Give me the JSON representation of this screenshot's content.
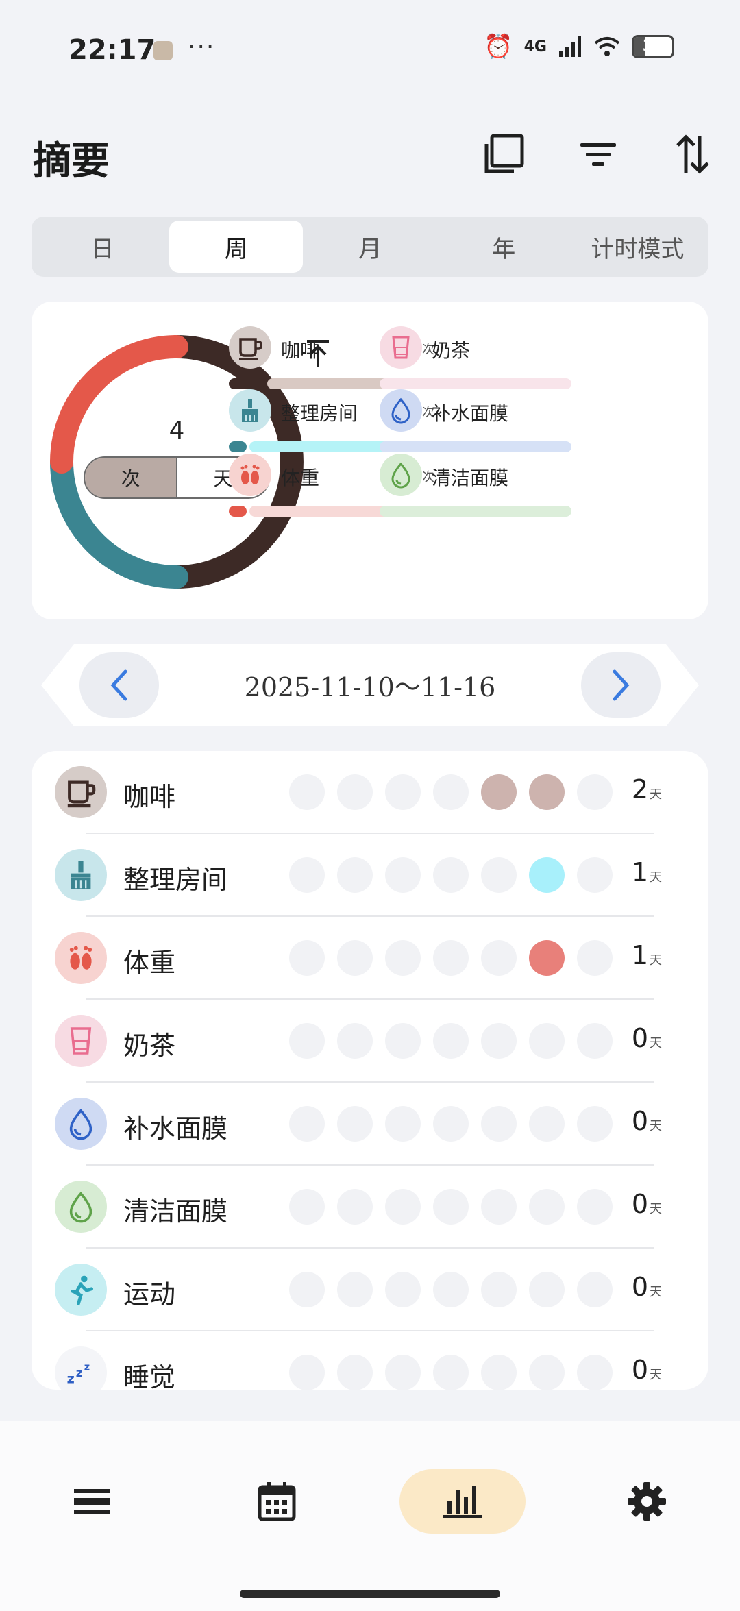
{
  "status_bar": {
    "time": "22:17",
    "dots": "···",
    "network": "4G",
    "battery": "31",
    "battery_fraction": 0.31
  },
  "header": {
    "title": "摘要"
  },
  "tabs": [
    {
      "label": "日",
      "active": false
    },
    {
      "label": "周",
      "active": true
    },
    {
      "label": "月",
      "active": false
    },
    {
      "label": "年",
      "active": false
    },
    {
      "label": "计时模式",
      "active": false
    }
  ],
  "summary": {
    "total": "4",
    "toggle": [
      {
        "label": "次",
        "active": true
      },
      {
        "label": "天",
        "active": false
      }
    ],
    "donut": [
      {
        "name": "咖啡",
        "value": 2,
        "color": "#3d2a26"
      },
      {
        "name": "整理房间",
        "value": 1,
        "color": "#3b8591"
      },
      {
        "name": "体重",
        "value": 1,
        "color": "#e4584a"
      }
    ],
    "legend": [
      {
        "name": "咖啡",
        "count": "2",
        "unit": "次",
        "icon": "coffee-cup-icon",
        "bg": "#d6ccc8",
        "color": "#3d2a26",
        "track": "#d9c9c3"
      },
      {
        "name": "奶茶",
        "count": "",
        "unit": "",
        "icon": "milk-tea-cup-icon",
        "bg": "#f7dbe3",
        "color": "#e96d8f",
        "track": "#f8e4ea"
      },
      {
        "name": "整理房间",
        "count": "1",
        "unit": "次",
        "icon": "broom-icon",
        "bg": "#c8e6eb",
        "color": "#3b8591",
        "track": "#b5f3f7"
      },
      {
        "name": "补水面膜",
        "count": "",
        "unit": "",
        "icon": "water-drop-icon",
        "bg": "#cfdaf3",
        "color": "#2f62c7",
        "track": "#d6e1f6"
      },
      {
        "name": "体重",
        "count": "1",
        "unit": "次",
        "icon": "footprints-icon",
        "bg": "#f7d3d0",
        "color": "#e4584a",
        "track": "#f7d9d7"
      },
      {
        "name": "清洁面膜",
        "count": "",
        "unit": "",
        "icon": "green-drop-icon",
        "bg": "#d7ecd3",
        "color": "#5fa34a",
        "track": "#dceeda"
      }
    ]
  },
  "date_range": {
    "label": "2025-11-10～11-16"
  },
  "list": [
    {
      "name": "咖啡",
      "value": "2",
      "unit": "天",
      "icon": "coffee-cup-icon",
      "bg": "#d6ccc8",
      "color": "#3d2a26",
      "fill": "#cdb3ae",
      "days": [
        0,
        0,
        0,
        0,
        1,
        1,
        0
      ]
    },
    {
      "name": "整理房间",
      "value": "1",
      "unit": "天",
      "icon": "broom-icon",
      "bg": "#c8e6eb",
      "color": "#3b8591",
      "fill": "#a8f0fb",
      "days": [
        0,
        0,
        0,
        0,
        0,
        1,
        0
      ]
    },
    {
      "name": "体重",
      "value": "1",
      "unit": "天",
      "icon": "footprints-icon",
      "bg": "#f7d3d0",
      "color": "#e4584a",
      "fill": "#e8807a",
      "days": [
        0,
        0,
        0,
        0,
        0,
        1,
        0
      ]
    },
    {
      "name": "奶茶",
      "value": "0",
      "unit": "天",
      "icon": "milk-tea-cup-icon",
      "bg": "#f7dbe3",
      "color": "#e96d8f",
      "fill": "#f1f2f5",
      "days": [
        0,
        0,
        0,
        0,
        0,
        0,
        0
      ]
    },
    {
      "name": "补水面膜",
      "value": "0",
      "unit": "天",
      "icon": "water-drop-icon",
      "bg": "#cfdaf3",
      "color": "#2f62c7",
      "fill": "#f1f2f5",
      "days": [
        0,
        0,
        0,
        0,
        0,
        0,
        0
      ]
    },
    {
      "name": "清洁面膜",
      "value": "0",
      "unit": "天",
      "icon": "green-drop-icon",
      "bg": "#d7ecd3",
      "color": "#5fa34a",
      "fill": "#f1f2f5",
      "days": [
        0,
        0,
        0,
        0,
        0,
        0,
        0
      ]
    },
    {
      "name": "运动",
      "value": "0",
      "unit": "天",
      "icon": "running-person-icon",
      "bg": "#c6eef2",
      "color": "#2aa3b8",
      "fill": "#f1f2f5",
      "days": [
        0,
        0,
        0,
        0,
        0,
        0,
        0
      ]
    },
    {
      "name": "睡觉",
      "value": "0",
      "unit": "天",
      "icon": "zzz-sleep-icon",
      "bg": "#f4f5f8",
      "color": "#2f5fc4",
      "fill": "#f1f2f5",
      "days": [
        0,
        0,
        0,
        0,
        0,
        0,
        0
      ]
    }
  ],
  "bottom_nav": [
    {
      "icon": "list-menu-icon",
      "active": false
    },
    {
      "icon": "calendar-icon",
      "active": false
    },
    {
      "icon": "bar-chart-icon",
      "active": true
    },
    {
      "icon": "settings-gear-icon",
      "active": false
    }
  ],
  "colors": {
    "accent_nav": "#fbe9c7",
    "arrow_blue": "#3a7be0"
  }
}
